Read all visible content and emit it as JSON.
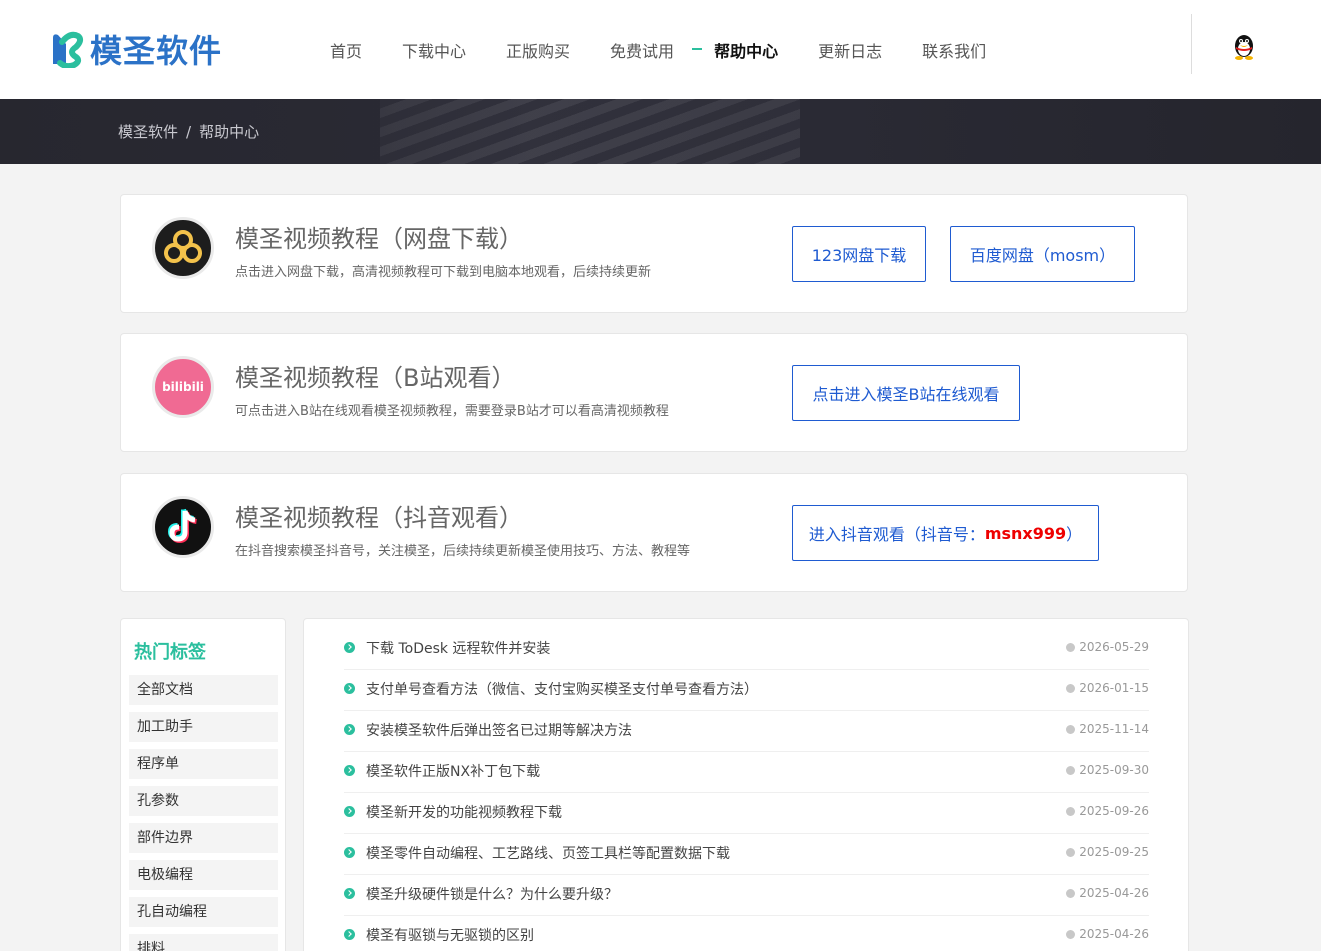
{
  "header": {
    "logo_text": "模圣软件",
    "nav": [
      {
        "label": "首页",
        "active": false
      },
      {
        "label": "下载中心",
        "active": false
      },
      {
        "label": "正版购买",
        "active": false
      },
      {
        "label": "免费试用",
        "active": false
      },
      {
        "label": "帮助中心",
        "active": true
      },
      {
        "label": "更新日志",
        "active": false
      },
      {
        "label": "联系我们",
        "active": false
      }
    ],
    "right_icon": "qq-penguin-icon"
  },
  "breadcrumb": {
    "home": "模圣软件",
    "separator": "/",
    "current": "帮助中心"
  },
  "cards": [
    {
      "title": "模圣视频教程（网盘下载）",
      "desc": "点击进入网盘下载，高清视频教程可下载到电脑本地观看，后续持续更新",
      "icon": "baidu-netdisk-icon",
      "buttons": [
        "123网盘下载",
        "百度网盘（mosm）"
      ]
    },
    {
      "title": "模圣视频教程（B站观看）",
      "desc": "可点击进入B站在线观看模圣视频教程，需要登录B站才可以看高清视频教程",
      "icon": "bilibili-icon",
      "icon_text": "bilibili",
      "buttons": [
        "点击进入模圣B站在线观看"
      ]
    },
    {
      "title": "模圣视频教程（抖音观看）",
      "desc": "在抖音搜索模圣抖音号，关注模圣，后续持续更新模圣使用技巧、方法、教程等",
      "icon": "douyin-icon",
      "button_prefix": "进入抖音观看（抖音号：",
      "button_highlight": "msnx999",
      "button_suffix": "）"
    }
  ],
  "sidebar": {
    "title": "热门标签",
    "tags": [
      "全部文档",
      "加工助手",
      "程序单",
      "孔参数",
      "部件边界",
      "电极编程",
      "孔自动编程",
      "排料"
    ]
  },
  "articles": [
    {
      "title": "下载 ToDesk 远程软件并安装",
      "date": "2026-05-29"
    },
    {
      "title": "支付单号查看方法（微信、支付宝购买模圣支付单号查看方法）",
      "date": "2026-01-15"
    },
    {
      "title": "安装模圣软件后弹出签名已过期等解决方法",
      "date": "2025-11-14"
    },
    {
      "title": "模圣软件正版NX补丁包下载",
      "date": "2025-09-30"
    },
    {
      "title": "模圣新开发的功能视频教程下载",
      "date": "2025-09-26"
    },
    {
      "title": "模圣零件自动编程、工艺路线、页签工具栏等配置数据下载",
      "date": "2025-09-25"
    },
    {
      "title": "模圣升级硬件锁是什么？为什么要升级？",
      "date": "2025-04-26"
    },
    {
      "title": "模圣有驱锁与无驱锁的区别",
      "date": "2025-04-26"
    }
  ],
  "colors": {
    "accent_green": "#2bbf9e",
    "link_blue": "#1f5bd1",
    "logo_blue": "#2b72c7",
    "highlight_red": "#e00000"
  }
}
